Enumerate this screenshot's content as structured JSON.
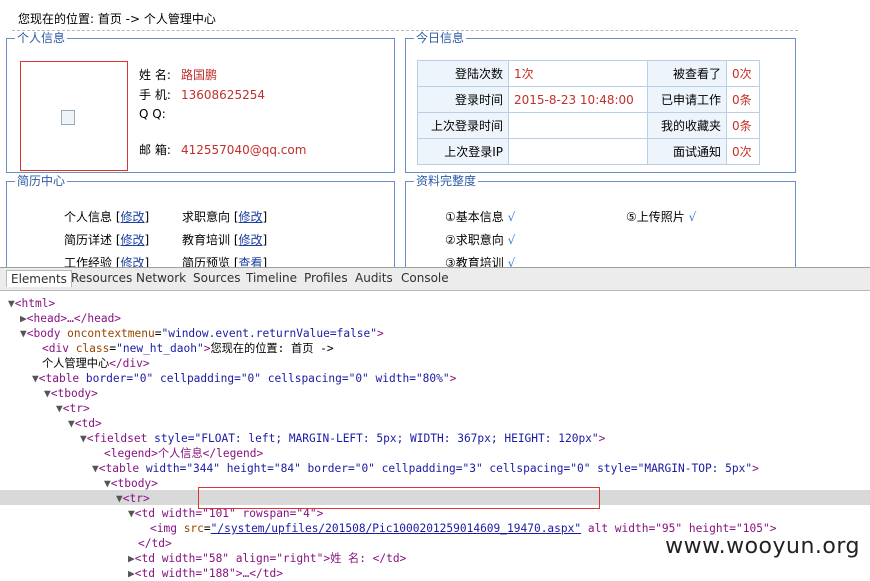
{
  "breadcrumb": "您现在的位置: 首页 -> 个人管理中心",
  "personal": {
    "legend": "个人信息",
    "rows": [
      {
        "label": "姓 名:",
        "value": "路国鹏"
      },
      {
        "label": "手 机:",
        "value": "13608625254"
      },
      {
        "label": "Q  Q:",
        "value": ""
      },
      {
        "label": "邮 箱:",
        "value": "412557040@qq.com"
      }
    ]
  },
  "today": {
    "legend": "今日信息",
    "rows": [
      {
        "l1": "登陆次数",
        "v1": "1次",
        "l2": "被查看了",
        "v2": "0次"
      },
      {
        "l1": "登录时间",
        "v1": "2015-8-23 10:48:00",
        "l2": "已申请工作",
        "v2": "0条"
      },
      {
        "l1": "上次登录时间",
        "v1": "",
        "l2": "我的收藏夹",
        "v2": "0条"
      },
      {
        "l1": "上次登录IP",
        "v1": "",
        "l2": "面试通知",
        "v2": "0次"
      }
    ]
  },
  "resume": {
    "legend": "简历中心",
    "items": [
      {
        "label": "个人信息",
        "link": "修改"
      },
      {
        "label": "求职意向",
        "link": "修改"
      },
      {
        "label": "简历详述",
        "link": "修改"
      },
      {
        "label": "教育培训",
        "link": "修改"
      },
      {
        "label": "工作经验",
        "link": "修改"
      },
      {
        "label": "简历预览",
        "link": "查看"
      }
    ]
  },
  "completeness": {
    "legend": "资料完整度",
    "items": [
      "①基本信息",
      "⑤上传照片",
      "②求职意向",
      "③教育培训"
    ],
    "check": "√"
  },
  "devtools": {
    "tabs": [
      "Elements",
      "Resources",
      "Network",
      "Sources",
      "Timeline",
      "Profiles",
      "Audits",
      "Console"
    ],
    "dom": {
      "html": "<html>",
      "head": "<head>…</head>",
      "body_open": "<body ",
      "body_attr": "oncontextmenu",
      "body_val": "\"window.event.returnValue=false\"",
      "div_open": "<div ",
      "div_attr": "class",
      "div_val": "\"new_ht_daoh\"",
      "div_text1": "您现在的位置: 首页 ->",
      "div_text2": "个人管理中心",
      "div_close": "</div>",
      "table_open": "<table ",
      "table_attrs": "border=\"0\" cellpadding=\"0\" cellspacing=\"0\" width=\"80%\"",
      "tbody": "<tbody>",
      "tr": "<tr>",
      "td": "<td>",
      "fieldset_open": "<fieldset ",
      "fieldset_attrs": "style=\"FLOAT: left; MARGIN-LEFT: 5px; WIDTH: 367px; HEIGHT: 120px\"",
      "legend_line": "<legend>个人信息</legend>",
      "table2_open": "<table ",
      "table2_attrs": "width=\"344\" height=\"84\" border=\"0\" cellpadding=\"3\" cellspacing=\"0\" style=\"MARGIN-TOP: 5px\"",
      "td_rowspan": "<td width=\"101\" rowspan=\"4\">",
      "img_open": "<img ",
      "img_src_attr": "src",
      "img_src_val": "\"/system/upfiles/201508/Pic1000201259014609_19470.aspx\"",
      "img_rest": " alt width=\"95\" height=\"105\">",
      "td_close": "</td>",
      "td58": "<td width=\"58\" align=\"right\">姓 名: </td>",
      "td188": "<td width=\"188\">…</td>"
    }
  },
  "watermark": "www.wooyun.org"
}
